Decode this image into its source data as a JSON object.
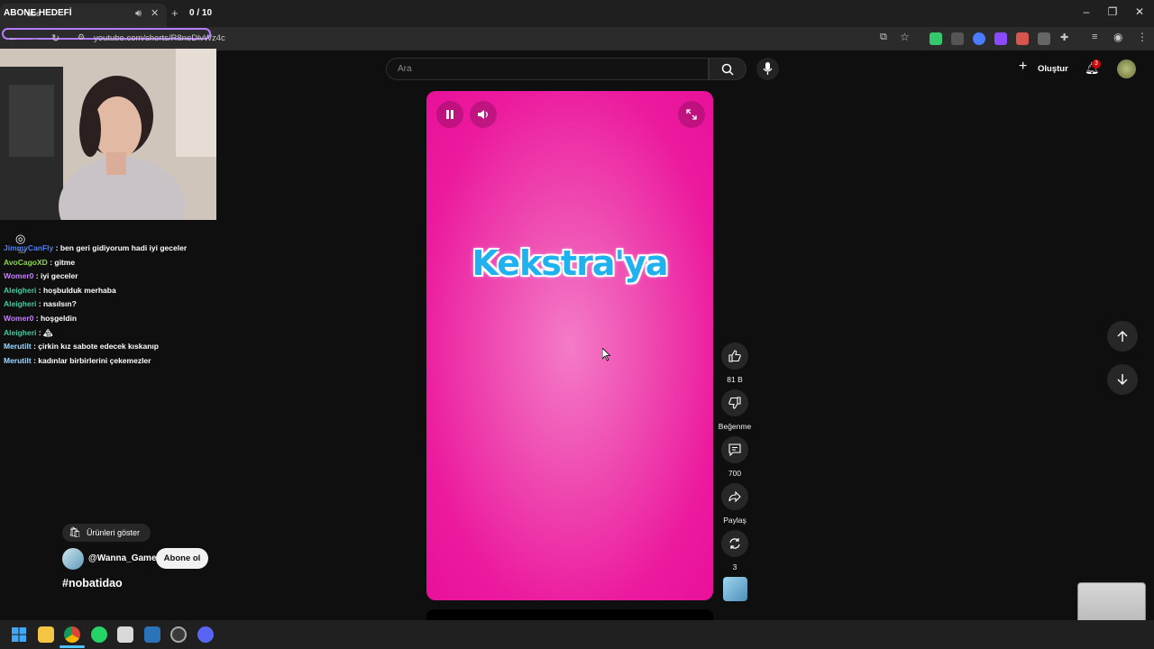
{
  "browser": {
    "tab_title": "ube",
    "url": "youtube.com/shorts/R8neDlvWz4c"
  },
  "overlay": {
    "goal_label": "ABONE HEDEFİ",
    "goal_count": "0 / 10",
    "viewer_label": "Siz",
    "chat": [
      {
        "user": "JimmyCanFly",
        "message": ": ben geri gidiyorum hadi iyi geceler",
        "color": "#4a7fff"
      },
      {
        "user": "AvoCagoXD",
        "message": ": gitme",
        "color": "#8bd64a"
      },
      {
        "user": "Womer0",
        "message": ": iyi geceler",
        "color": "#c77dff"
      },
      {
        "user": "Aleigheri",
        "message": ": hoşbulduk merhaba",
        "color": "#39d1a1"
      },
      {
        "user": "Aleigheri",
        "message": ": nasılsın?",
        "color": "#39d1a1"
      },
      {
        "user": "Womer0",
        "message": ": hoşgeldin",
        "color": "#c77dff"
      },
      {
        "user": "Aleigheri",
        "message": ": 🏔",
        "color": "#39d1a1"
      },
      {
        "user": "Merutilt",
        "message": ": çirkin kız sabote edecek kıskanıp",
        "color": "#9fd8ff"
      },
      {
        "user": "Merutilt",
        "message": ": kadınlar birbirlerini çekemezler",
        "color": "#9fd8ff"
      }
    ]
  },
  "youtube": {
    "search_placeholder": "Ara",
    "create_label": "Oluştur",
    "notification_count": "3",
    "video_text": "Kekstra'ya",
    "likes": "81 B",
    "dislike_label": "Beğenme",
    "comments": "700",
    "share_label": "Paylaş",
    "remix_count": "3",
    "products_label": "Ürünleri göster",
    "channel": "@Wanna_Gamer",
    "subscribe_label": "Abone ol",
    "hashtag": "#nobatidao",
    "accent": "#ec1a9e"
  }
}
